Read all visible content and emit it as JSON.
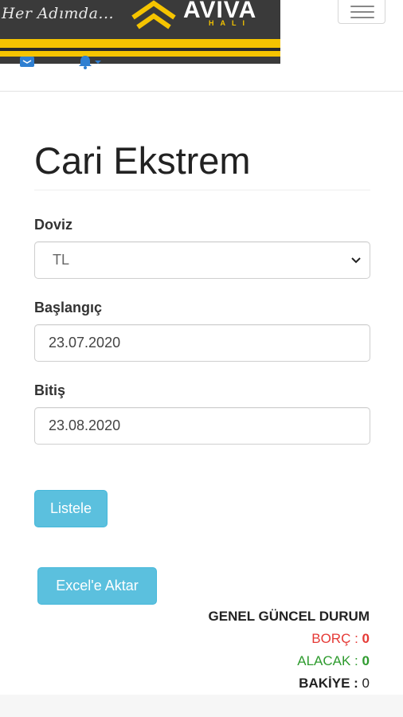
{
  "header": {
    "logo_tagline": "Her Adımda...",
    "logo_brand": "AVIVA",
    "logo_sub": "HALI"
  },
  "page": {
    "title": "Cari Ekstrem"
  },
  "form": {
    "doviz_label": "Doviz",
    "doviz_value": "TL",
    "start_label": "Başlangıç",
    "start_value": "23.07.2020",
    "end_label": "Bitiş",
    "end_value": "23.08.2020",
    "list_button": "Listele",
    "excel_button": "Excel'e Aktar"
  },
  "summary": {
    "heading": "GENEL GÜNCEL DURUM",
    "borc_label": "BORÇ :",
    "borc_value": "0",
    "alacak_label": "ALACAK :",
    "alacak_value": "0",
    "bakiye_label": "BAKİYE :",
    "bakiye_value": "0"
  },
  "colors": {
    "accent": "#5bc0de",
    "borc": "#e53935",
    "alacak": "#2e9b2e",
    "bakiye": "#222222",
    "nav_icon": "#2f7fd1"
  },
  "icons": [
    "envelope-icon",
    "bell-icon",
    "hamburger-icon",
    "chevron-down-icon"
  ]
}
